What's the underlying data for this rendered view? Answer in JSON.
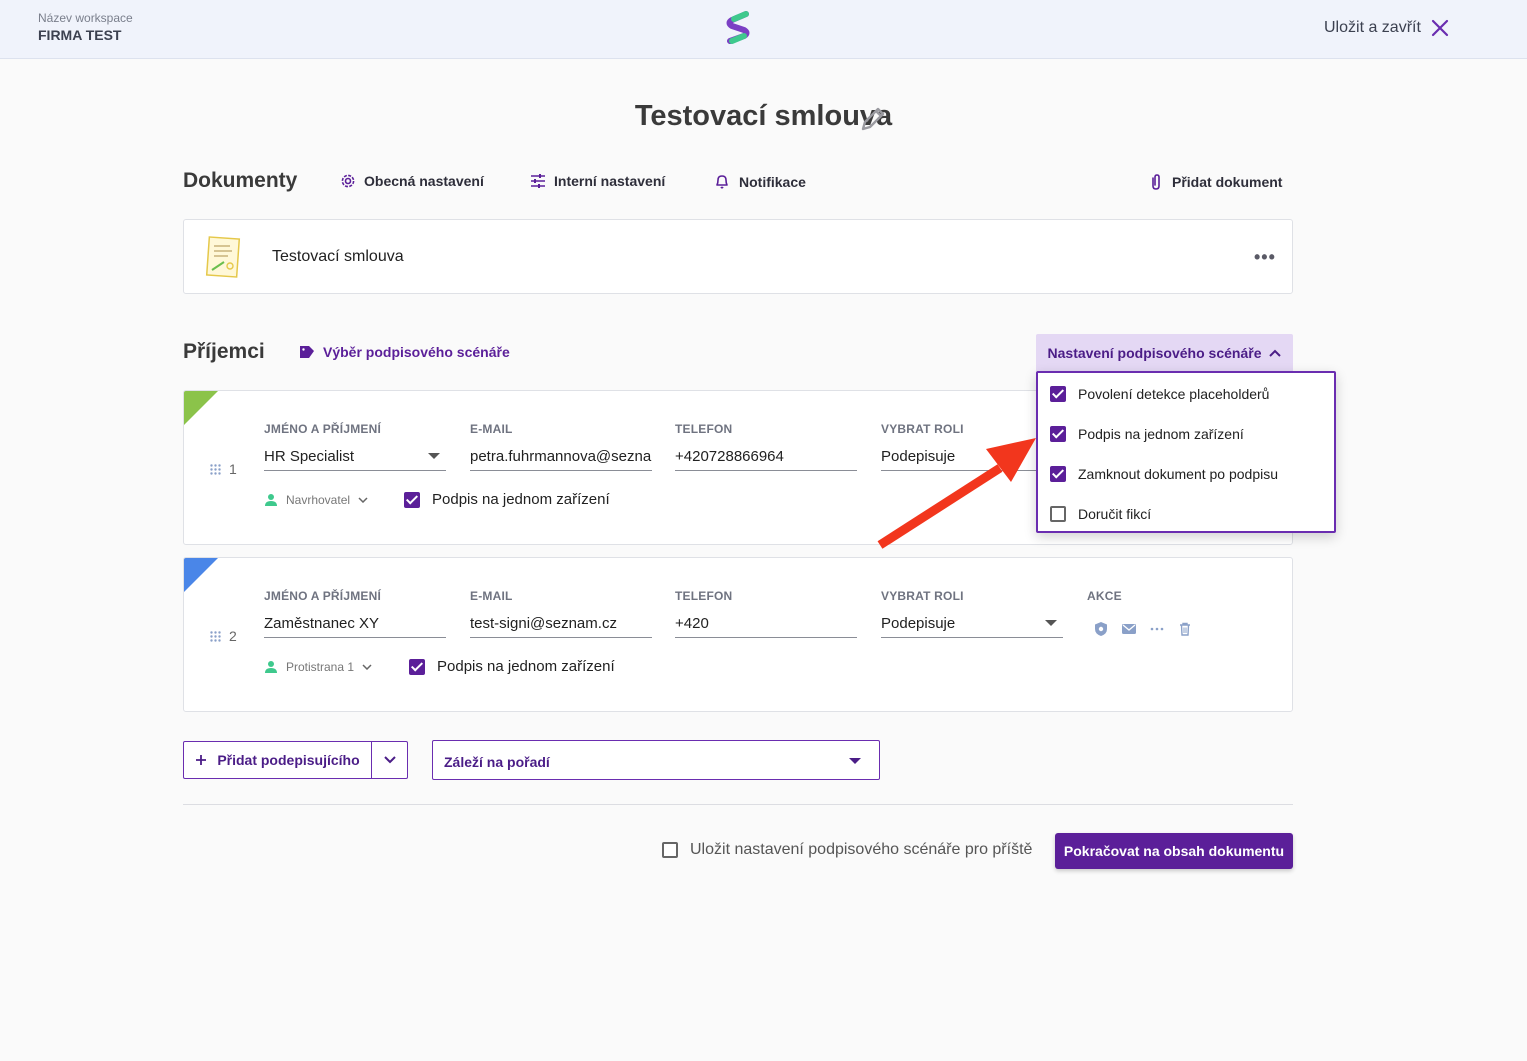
{
  "header": {
    "workspace_label": "Název workspace",
    "workspace_name": "FIRMA TEST",
    "close_label": "Uložit a zavřít"
  },
  "title": "Testovací smlouva",
  "documents": {
    "heading": "Dokumenty",
    "general_settings": "Obecná nastavení",
    "internal_settings": "Interní nastavení",
    "notifications": "Notifikace",
    "add_document": "Přidat dokument",
    "items": [
      {
        "name": "Testovací smlouva"
      }
    ]
  },
  "recipients": {
    "heading": "Příjemci",
    "scenario_choice": "Výběr podpisového scénáře",
    "scenario_settings": "Nastavení podpisového scénáře",
    "columns": {
      "name": "JMÉNO A PŘÍJMENÍ",
      "email": "E-MAIL",
      "phone": "TELEFON",
      "role": "VYBRAT ROLI",
      "actions": "AKCE"
    },
    "rows": [
      {
        "index": "1",
        "name": "HR Specialist",
        "email": "petra.fuhrmannova@seznam.",
        "phone": "+420728866964",
        "role": "Podepisuje",
        "party": "Navrhovatel",
        "single_device": "Podpis na jednom zařízení",
        "corner_color": "#8bc34a"
      },
      {
        "index": "2",
        "name": "Zaměstnanec XY",
        "email": "test-signi@seznam.cz",
        "phone": "+420",
        "role": "Podepisuje",
        "party": "Protistrana 1",
        "single_device": "Podpis na jednom zařízení",
        "corner_color": "#4a86e8"
      }
    ],
    "dropdown": [
      {
        "label": "Povolení detekce placeholderů",
        "checked": true
      },
      {
        "label": "Podpis na jednom zařízení",
        "checked": true
      },
      {
        "label": "Zamknout dokument po podpisu",
        "checked": true
      },
      {
        "label": "Doručit fikcí",
        "checked": false
      }
    ]
  },
  "footer": {
    "add_signer": "Přidat podepisujícího",
    "order": "Záleží na pořadí",
    "save_settings": "Uložit nastavení podpisového scénáře pro příště",
    "continue": "Pokračovat na obsah dokumentu"
  },
  "colors": {
    "accent": "#5b1f99",
    "annotation_arrow": "#f2361d"
  }
}
